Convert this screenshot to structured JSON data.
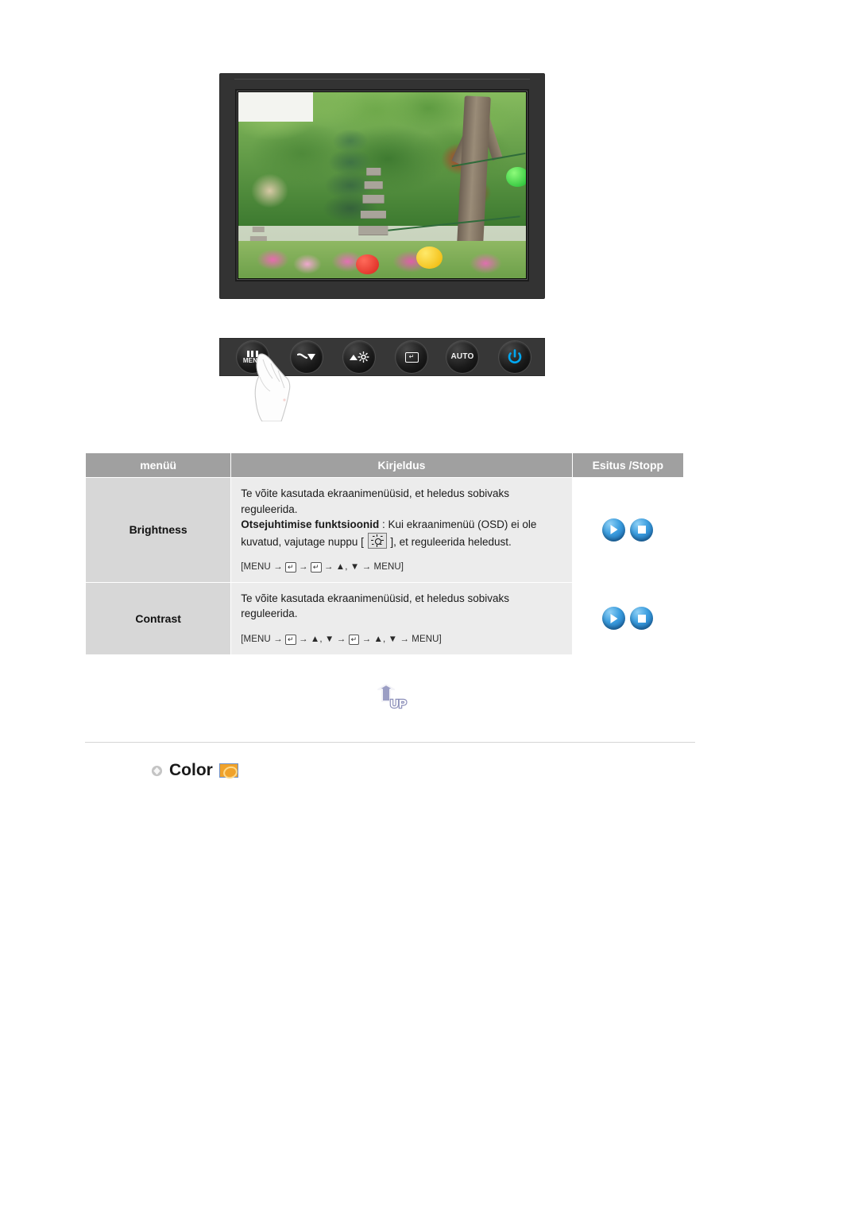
{
  "monitor": {
    "screen_alt": "garden-photo-with-stone-pagoda-trees-and-lanterns"
  },
  "control_panel": {
    "buttons": [
      {
        "name": "menu-button",
        "label": "MENU",
        "icon": "menu-bars-icon"
      },
      {
        "name": "down-button",
        "label": "",
        "icon": "down-arrow-icon"
      },
      {
        "name": "brightness-button",
        "label": "",
        "icon": "brightness-sun-icon"
      },
      {
        "name": "enter-button",
        "label": "",
        "icon": "enter-return-icon"
      },
      {
        "name": "auto-button",
        "label": "AUTO",
        "icon": "auto-text-icon"
      },
      {
        "name": "power-button",
        "label": "",
        "icon": "power-icon"
      }
    ],
    "power_color": "#00a7f0"
  },
  "table": {
    "headers": {
      "menu": "menüü",
      "description": "Kirjeldus",
      "control": "Esitus /Stopp"
    },
    "rows": [
      {
        "menu": "Brightness",
        "desc_line1": "Te võite kasutada ekraanimenüüsid, et heledus sobivaks reguleerida.",
        "desc_bold": "Otsejuhtimise funktsioonid",
        "desc_after_bold_a": " : Kui ekraanimenüü (OSD) ei ole kuvatud, vajutage nuppu [ ",
        "desc_after_bold_b": " ], et reguleerida heledust.",
        "path_prefix": "[MENU",
        "path_suffix": "MENU]",
        "path_tokens": [
          "↵",
          "↵",
          "▲, ▼"
        ],
        "controls": [
          "play-button",
          "stop-button"
        ]
      },
      {
        "menu": "Contrast",
        "desc_line1": "Te võite kasutada ekraanimenüüsid, et heledus sobivaks reguleerida.",
        "path_prefix": "[MENU",
        "path_suffix": "MENU]",
        "path_tokens": [
          "↵",
          "▲, ▼",
          "↵",
          "▲, ▼"
        ],
        "controls": [
          "play-button",
          "stop-button"
        ]
      }
    ],
    "colors": {
      "header_bg": "#a0a0a0",
      "menu_cell_bg": "#d7d7d7",
      "desc_cell_bg": "#ececec"
    }
  },
  "up_button": {
    "label": "UP"
  },
  "section": {
    "color_heading": "Color"
  }
}
